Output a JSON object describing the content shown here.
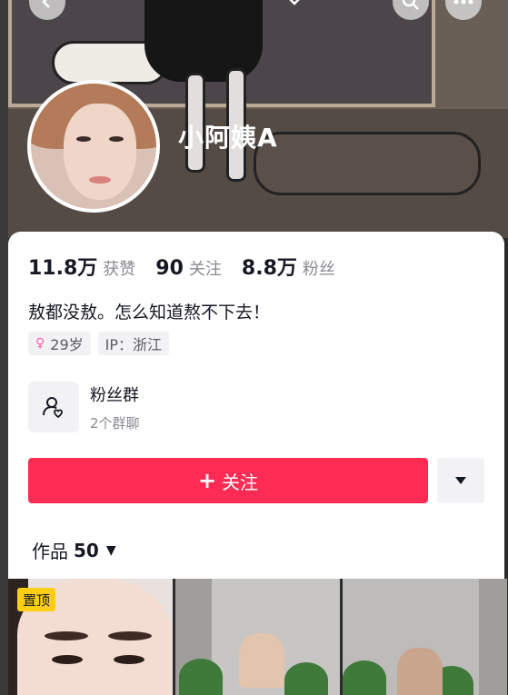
{
  "profile": {
    "nickname": "小阿姨A",
    "stats": [
      {
        "num": "11.8万",
        "label": "获赞"
      },
      {
        "num": "90",
        "label": "关注"
      },
      {
        "num": "8.8万",
        "label": "粉丝"
      }
    ],
    "bio": "敖都没敖。怎么知道熬不下去！",
    "tags": {
      "age": "29岁",
      "ip": "IP：浙江"
    },
    "fan_group": {
      "title": "粉丝群",
      "subtitle": "2个群聊"
    },
    "follow_label": "关注",
    "follow_plus": "+"
  },
  "works": {
    "label": "作品",
    "count": "50",
    "pinned_badge": "置顶"
  },
  "colors": {
    "accent": "#fe2c55",
    "badge": "#face15"
  },
  "icons": {
    "back": "chevron-left-icon",
    "search": "search-icon",
    "more": "more-icon",
    "gender": "female-icon",
    "group": "group-icon",
    "dropdown": "caret-down-icon"
  }
}
